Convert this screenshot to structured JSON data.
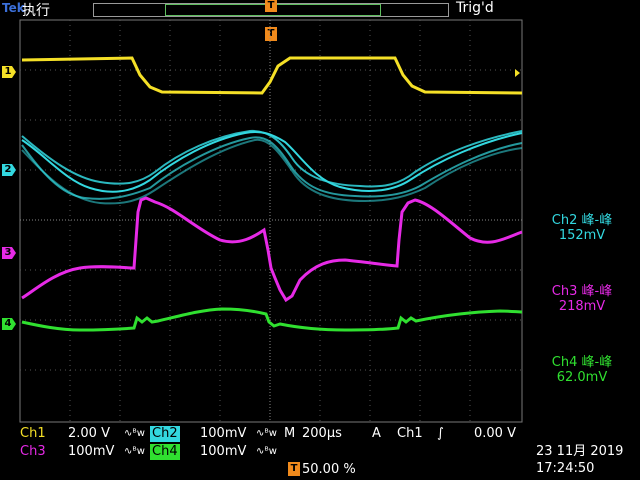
{
  "header": {
    "brand": "Tek",
    "state": "执行",
    "trigger_status": "Trig'd",
    "trigger_marker": "T"
  },
  "channel_markers": [
    {
      "id": "ch1",
      "label": "1",
      "color": "#f5e027"
    },
    {
      "id": "ch2",
      "label": "2",
      "color": "#33d8e0"
    },
    {
      "id": "ch3",
      "label": "3",
      "color": "#e62ae6"
    },
    {
      "id": "ch4",
      "label": "4",
      "color": "#30e030"
    }
  ],
  "measurements": {
    "ch2": {
      "title": "Ch2 峰-峰",
      "value": "152mV",
      "color": "#33d8e0"
    },
    "ch3": {
      "title": "Ch3 峰-峰",
      "value": "218mV",
      "color": "#e62ae6"
    },
    "ch4": {
      "title": "Ch4 峰-峰",
      "value": "62.0mV",
      "color": "#30e030"
    }
  },
  "status": {
    "ch1_label": "Ch1",
    "ch1_scale": "2.00 V",
    "ch1_coupling": "∿ᴮw",
    "ch2_label": "Ch2",
    "ch2_scale": "100mV",
    "ch2_coupling": "∿ᴮw",
    "ch3_label": "Ch3",
    "ch3_scale": "100mV",
    "ch3_coupling": "∿ᴮw",
    "ch4_label": "Ch4",
    "ch4_scale": "100mV",
    "ch4_coupling": "∿ᴮw",
    "timebase_label": "M",
    "timebase": "200µs",
    "trigger_mode": "A",
    "trigger_source": "Ch1",
    "trigger_slope": "∫",
    "trigger_level": "0.00 V",
    "trigger_position_marker": "T",
    "trigger_position": "50.00 %",
    "date": "23 11月 2019",
    "time": "17:24:50"
  },
  "colors": {
    "ch1": "#f5e027",
    "ch2": "#33d8e0",
    "ch3": "#e62ae6",
    "ch4": "#30e030",
    "grid": "#6a6a6a",
    "trigger": "#f08a1c"
  }
}
